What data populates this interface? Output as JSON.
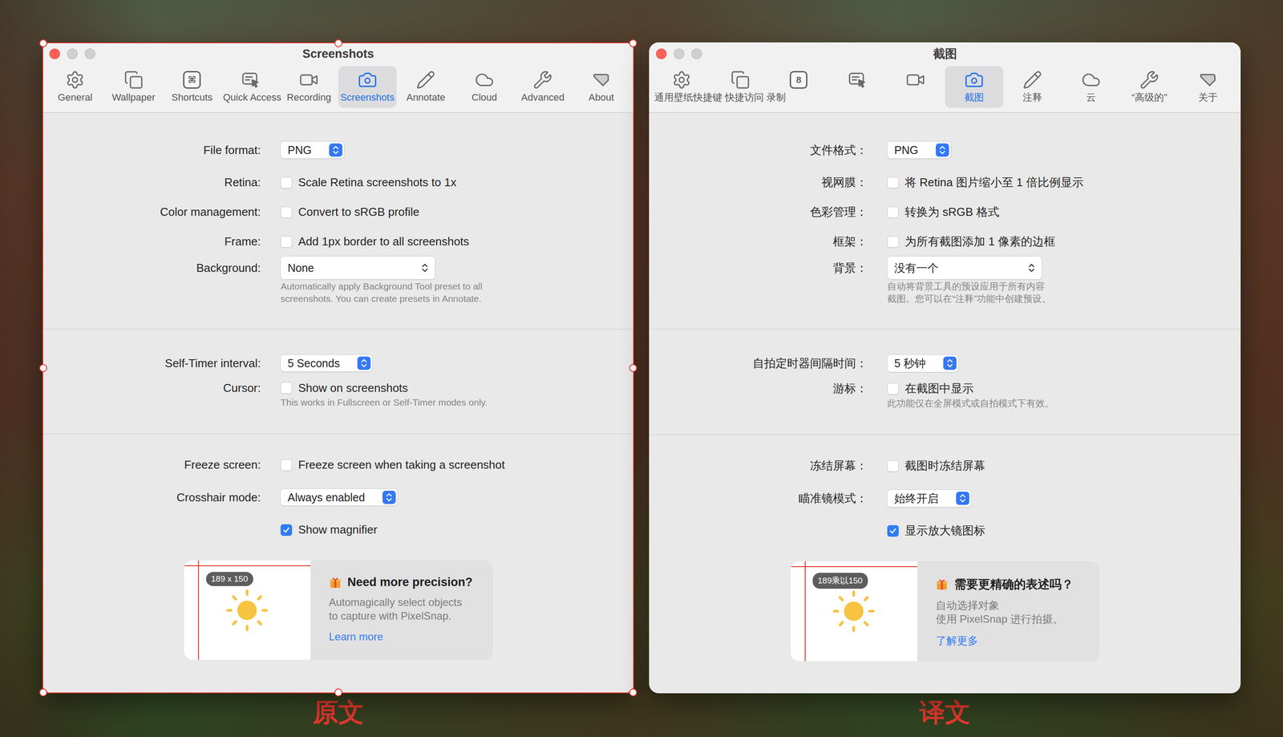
{
  "windows": [
    {
      "title": "Screenshots",
      "selected": true,
      "tabs": [
        {
          "kind": "general",
          "label": "General",
          "selected": false
        },
        {
          "kind": "wallpaper",
          "label": "Wallpaper",
          "selected": false
        },
        {
          "kind": "shortcuts",
          "keycap": "⌘",
          "label": "Shortcuts",
          "selected": false
        },
        {
          "kind": "quick-access",
          "label": "Quick Access",
          "selected": false
        },
        {
          "kind": "recording",
          "label": "Recording",
          "selected": false
        },
        {
          "kind": "screenshots",
          "label": "Screenshots",
          "selected": true
        },
        {
          "kind": "annotate",
          "label": "Annotate",
          "selected": false
        },
        {
          "kind": "cloud",
          "label": "Cloud",
          "selected": false
        },
        {
          "kind": "advanced",
          "label": "Advanced",
          "selected": false
        },
        {
          "kind": "about",
          "label": "About",
          "selected": false
        }
      ],
      "sections": [
        {
          "rows": [
            {
              "kind": "stepper-popup",
              "label": "File format:",
              "value": "PNG"
            },
            {
              "kind": "checkbox",
              "label": "Retina:",
              "text": "Scale Retina screenshots to 1x",
              "checked": false
            },
            {
              "kind": "checkbox",
              "label": "Color management:",
              "text": "Convert to sRGB profile",
              "checked": false
            },
            {
              "kind": "checkbox",
              "label": "Frame:",
              "text": "Add 1px border to all screenshots",
              "checked": false
            },
            {
              "kind": "popup",
              "label": "Background:",
              "value": "None",
              "note": [
                "Automatically apply Background Tool preset to all",
                "screenshots. You can create presets in Annotate."
              ]
            }
          ]
        },
        {
          "rows": [
            {
              "kind": "stepper-popup",
              "label": "Self-Timer interval:",
              "value": "5 Seconds"
            },
            {
              "kind": "checkbox",
              "label": "Cursor:",
              "text": "Show on screenshots",
              "checked": false,
              "note": [
                "This works in Fullscreen or Self-Timer modes only."
              ]
            }
          ]
        },
        {
          "rows": [
            {
              "kind": "checkbox",
              "label": "Freeze screen:",
              "text": "Freeze screen when taking a screenshot",
              "checked": false
            },
            {
              "kind": "stepper-popup",
              "label": "Crosshair mode:",
              "value": "Always enabled"
            },
            {
              "kind": "checkbox",
              "text": "Show magnifier",
              "checked": true
            }
          ],
          "card": {
            "badge": "189 x 150",
            "title": "Need more precision?",
            "lines": [
              "Automagically select objects",
              "to capture with PixelSnap."
            ],
            "link": "Learn more"
          }
        }
      ]
    },
    {
      "title": "截图",
      "selected": false,
      "tabs": [
        {
          "kind": "general",
          "label": "通用壁纸快捷键 快捷访问 录制",
          "selected": false
        },
        {
          "kind": "wallpaper",
          "selected": false
        },
        {
          "kind": "shortcuts",
          "keycap": "8",
          "selected": false
        },
        {
          "kind": "quick-access",
          "selected": false
        },
        {
          "kind": "recording",
          "selected": false
        },
        {
          "kind": "screenshots",
          "label": "截图",
          "selected": true
        },
        {
          "kind": "annotate",
          "label": "注释",
          "selected": false
        },
        {
          "kind": "cloud",
          "label": "云",
          "selected": false
        },
        {
          "kind": "advanced",
          "label": "“高级的”",
          "selected": false
        },
        {
          "kind": "about",
          "label": "关于",
          "selected": false
        }
      ],
      "sections": [
        {
          "rows": [
            {
              "kind": "stepper-popup",
              "label": "文件格式：",
              "value": "PNG"
            },
            {
              "kind": "checkbox",
              "label": "视网膜：",
              "text": "将 Retina 图片缩小至 1 倍比例显示",
              "checked": false
            },
            {
              "kind": "checkbox",
              "label": "色彩管理：",
              "text": "转换为 sRGB 格式",
              "checked": false
            },
            {
              "kind": "checkbox",
              "label": "框架：",
              "text": "为所有截图添加 1 像素的边框",
              "checked": false
            },
            {
              "kind": "popup",
              "label": "背景：",
              "value": "没有一个",
              "note": [
                "自动将背景工具的预设应用于所有内容",
                "截图。您可以在“注释”功能中创建预设。"
              ]
            }
          ]
        },
        {
          "rows": [
            {
              "kind": "stepper-popup",
              "label": "自拍定时器间隔时间：",
              "value": "5 秒钟"
            },
            {
              "kind": "checkbox",
              "label": "游标：",
              "text": "在截图中显示",
              "checked": false,
              "note": [
                "此功能仅在全屏模式或自拍模式下有效。"
              ]
            }
          ]
        },
        {
          "rows": [
            {
              "kind": "checkbox",
              "label": "冻结屏幕：",
              "text": "截图时冻结屏幕",
              "checked": false
            },
            {
              "kind": "stepper-popup",
              "label": "瞄准镜模式：",
              "value": "始终开启"
            },
            {
              "kind": "checkbox",
              "text": "显示放大镜图标",
              "checked": true
            }
          ],
          "card": {
            "badge": "189乘以150",
            "title": "需要更精确的表述吗？",
            "lines": [
              "自动选择对象",
              "使用 PixelSnap 进行拍摄。"
            ],
            "link": "了解更多"
          }
        }
      ]
    }
  ],
  "captions": [
    "原文",
    "译文"
  ]
}
